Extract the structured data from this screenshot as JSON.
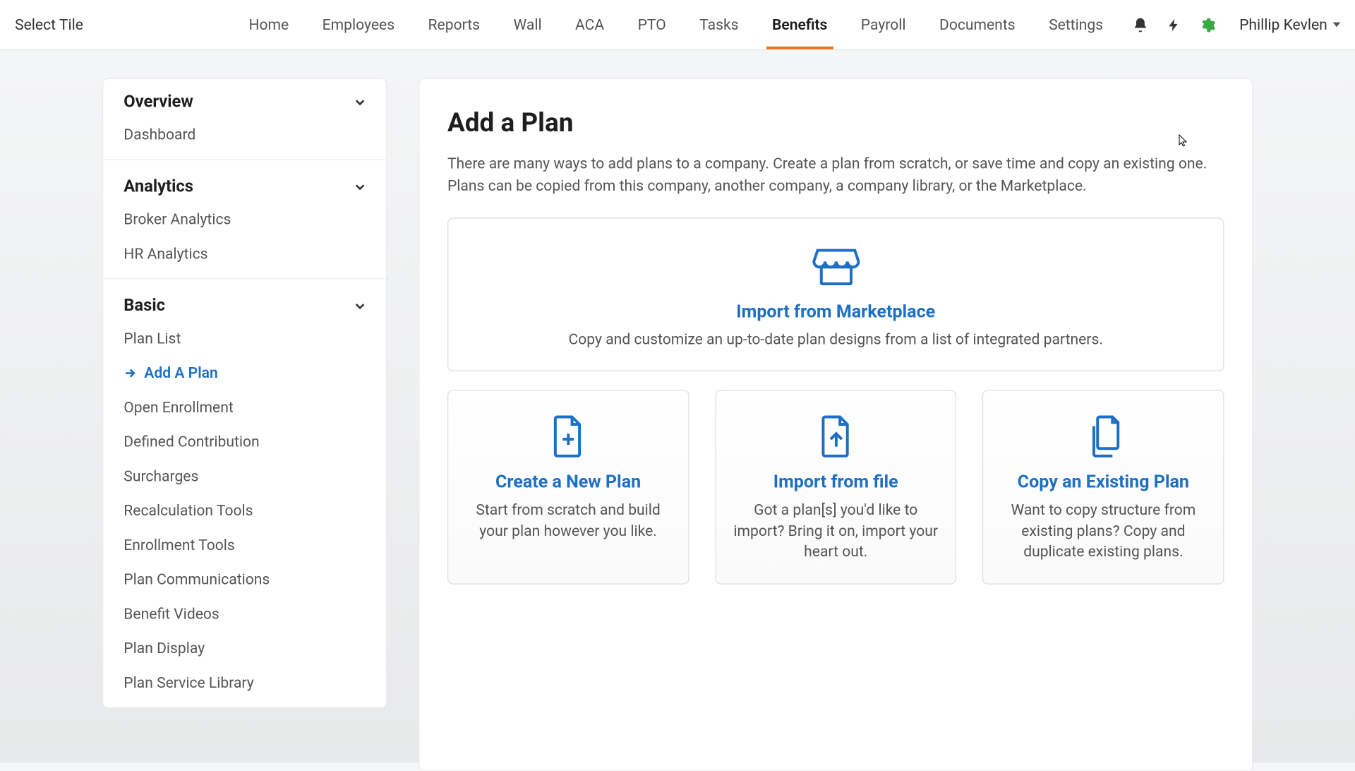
{
  "topnav": {
    "select_tile": "Select Tile",
    "items": [
      "Home",
      "Employees",
      "Reports",
      "Wall",
      "ACA",
      "PTO",
      "Tasks",
      "Benefits",
      "Payroll",
      "Documents",
      "Settings"
    ],
    "active_index": 7,
    "user_name": "Phillip Kevlen"
  },
  "sidebar": {
    "sections": [
      {
        "title": "Overview",
        "items": [
          "Dashboard"
        ]
      },
      {
        "title": "Analytics",
        "items": [
          "Broker Analytics",
          "HR Analytics"
        ]
      },
      {
        "title": "Basic",
        "items": [
          "Plan List",
          "Add A Plan",
          "Open Enrollment",
          "Defined Contribution",
          "Surcharges",
          "Recalculation Tools",
          "Enrollment Tools",
          "Plan Communications",
          "Benefit Videos",
          "Plan Display",
          "Plan Service Library"
        ],
        "active_index": 1
      }
    ]
  },
  "main": {
    "title": "Add a Plan",
    "description": "There are many ways to add plans to a company. Create a plan from scratch, or save time and copy an existing one. Plans can be copied from this company, another company, a company library, or the Marketplace.",
    "marketplace_card": {
      "title": "Import from Marketplace",
      "desc": "Copy and customize an up-to-date plan designs from a list of integrated partners."
    },
    "cards": [
      {
        "title": "Create a New Plan",
        "desc": "Start from scratch and build your plan however you like."
      },
      {
        "title": "Import from file",
        "desc": "Got a plan[s] you'd like to import? Bring it on, import your heart out."
      },
      {
        "title": "Copy an Existing Plan",
        "desc": "Want to copy structure from existing plans? Copy and duplicate existing plans."
      }
    ]
  }
}
